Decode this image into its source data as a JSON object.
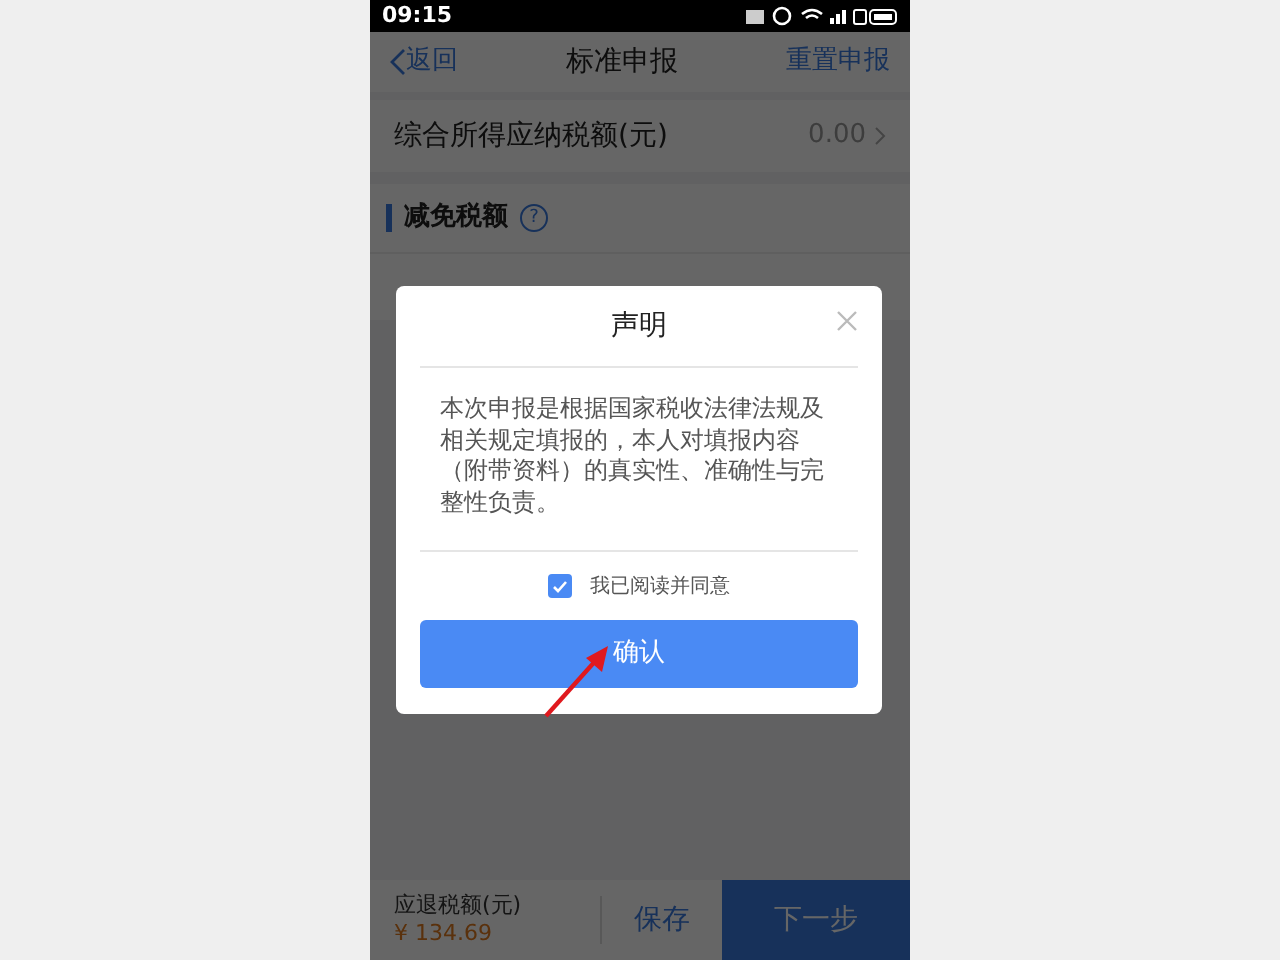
{
  "status_bar": {
    "time": "09:15"
  },
  "header": {
    "back": "返回",
    "title": "标准申报",
    "action": "重置申报"
  },
  "rows": [
    {
      "kind": "row",
      "label": "综合所得应纳税额(元)",
      "value": "0.00"
    },
    {
      "kind": "section",
      "label": "减免税额",
      "help": "?"
    }
  ],
  "dialog": {
    "title": "声明",
    "body": "本次申报是根据国家税收法律法规及相关规定填报的，本人对填报内容（附带资料）的真实性、准确性与完整性负责。",
    "agree": {
      "label": "我已阅读并同意",
      "checked": true
    },
    "confirm": "确认"
  },
  "footer": {
    "refund_label": "应退税额(元)",
    "refund_amount": "¥ 134.69",
    "save": "保存",
    "next": "下一步"
  }
}
